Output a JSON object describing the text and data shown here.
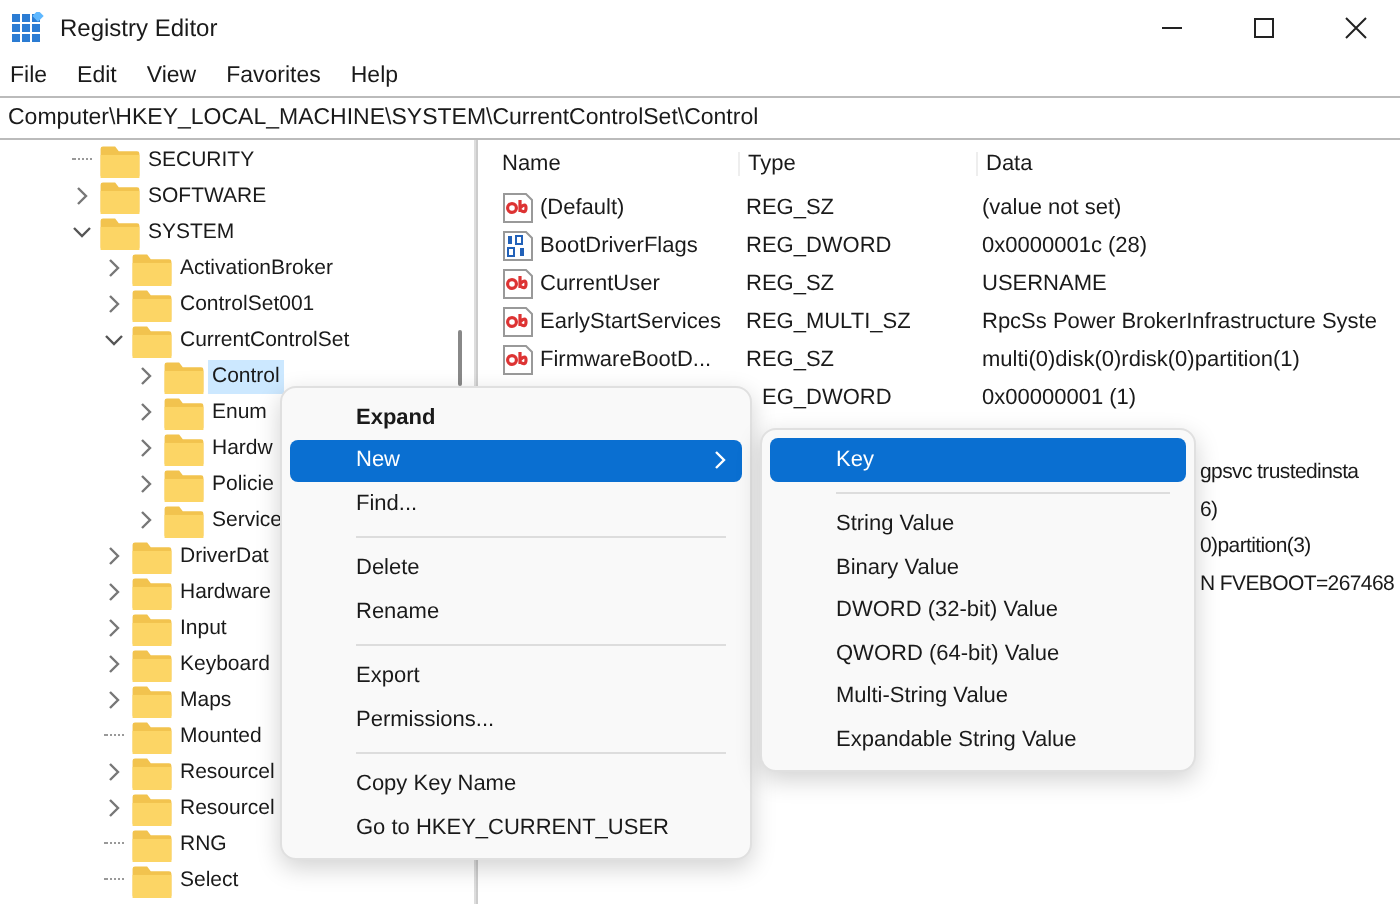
{
  "window": {
    "title": "Registry Editor"
  },
  "menu_bar": [
    "File",
    "Edit",
    "View",
    "Favorites",
    "Help"
  ],
  "address": "Computer\\HKEY_LOCAL_MACHINE\\SYSTEM\\CurrentControlSet\\Control",
  "tree": [
    {
      "label": "SECURITY",
      "selected": false
    },
    {
      "label": "SOFTWARE",
      "selected": false,
      "expanded": false
    },
    {
      "label": "SYSTEM",
      "selected": false,
      "expanded": true,
      "children": [
        {
          "label": "ActivationBroker",
          "selected": false,
          "expanded": false
        },
        {
          "label": "ControlSet001",
          "selected": false,
          "expanded": false
        },
        {
          "label": "CurrentControlSet",
          "selected": false,
          "expanded": true,
          "children": [
            {
              "label": "Control",
              "selected": true,
              "expanded": false
            },
            {
              "label": "Enum",
              "selected": false,
              "expanded": false
            },
            {
              "label": "Hardw",
              "selected": false,
              "expanded": false
            },
            {
              "label": "Policie",
              "selected": false,
              "expanded": false
            },
            {
              "label": "Service",
              "selected": false,
              "expanded": false
            }
          ]
        },
        {
          "label": "DriverDat",
          "selected": false,
          "expanded": false
        },
        {
          "label": "Hardware",
          "selected": false,
          "expanded": false
        },
        {
          "label": "Input",
          "selected": false,
          "expanded": false
        },
        {
          "label": "Keyboard",
          "selected": false,
          "expanded": false
        },
        {
          "label": "Maps",
          "selected": false,
          "expanded": false
        },
        {
          "label": "Mounted",
          "selected": false
        },
        {
          "label": "Resourcel",
          "selected": false,
          "expanded": false
        },
        {
          "label": "Resourcel",
          "selected": false,
          "expanded": false
        },
        {
          "label": "RNG",
          "selected": false
        },
        {
          "label": "Select",
          "selected": false
        }
      ]
    }
  ],
  "values": {
    "columns": [
      "Name",
      "Type",
      "Data"
    ],
    "rows": [
      {
        "kind": "string",
        "name": "(Default)",
        "type": "REG_SZ",
        "data": "(value not set)"
      },
      {
        "kind": "binary",
        "name": "BootDriverFlags",
        "type": "REG_DWORD",
        "data": "0x0000001c (28)"
      },
      {
        "kind": "string",
        "name": "CurrentUser",
        "type": "REG_SZ",
        "data": "USERNAME"
      },
      {
        "kind": "string",
        "name": "EarlyStartServices",
        "type": "REG_MULTI_SZ",
        "data": "RpcSs Power BrokerInfrastructure Syste"
      },
      {
        "kind": "string",
        "name": "FirmwareBootD...",
        "type": "REG_SZ",
        "data": "multi(0)disk(0)rdisk(0)partition(1)"
      },
      {
        "type": "EG_DWORD",
        "data": "0x00000001 (1)"
      }
    ],
    "data_behind_menu": [
      "gpsvc trustedinsta",
      "6)",
      "0)partition(3)",
      "N FVEBOOT=267468"
    ]
  },
  "context_menu": {
    "items": [
      {
        "kind": "item",
        "label": "Expand",
        "bold": true,
        "selected": false
      },
      {
        "kind": "submenu",
        "label": "New",
        "bold": false,
        "selected": true
      },
      {
        "kind": "item",
        "label": "Find...",
        "bold": false,
        "selected": false
      },
      {
        "kind": "separator"
      },
      {
        "kind": "item",
        "label": "Delete",
        "bold": false,
        "selected": false
      },
      {
        "kind": "item",
        "label": "Rename",
        "bold": false,
        "selected": false
      },
      {
        "kind": "separator"
      },
      {
        "kind": "item",
        "label": "Export",
        "bold": false,
        "selected": false
      },
      {
        "kind": "item",
        "label": "Permissions...",
        "bold": false,
        "selected": false
      },
      {
        "kind": "separator"
      },
      {
        "kind": "item",
        "label": "Copy Key Name",
        "bold": false,
        "selected": false
      },
      {
        "kind": "item",
        "label": "Go to HKEY_CURRENT_USER",
        "bold": false,
        "selected": false
      }
    ]
  },
  "submenu": {
    "items": [
      {
        "kind": "item",
        "label": "Key",
        "selected": true
      },
      {
        "kind": "separator"
      },
      {
        "kind": "item",
        "label": "String Value",
        "selected": false
      },
      {
        "kind": "item",
        "label": "Binary Value",
        "selected": false
      },
      {
        "kind": "item",
        "label": "DWORD (32-bit) Value",
        "selected": false
      },
      {
        "kind": "item",
        "label": "QWORD (64-bit) Value",
        "selected": false
      },
      {
        "kind": "item",
        "label": "Multi-String Value",
        "selected": false
      },
      {
        "kind": "item",
        "label": "Expandable String Value",
        "selected": false
      }
    ]
  }
}
